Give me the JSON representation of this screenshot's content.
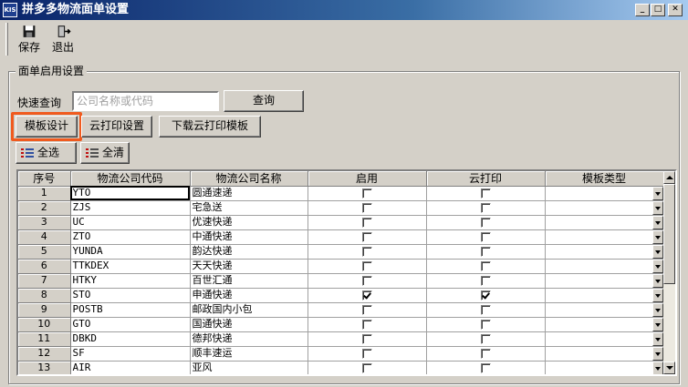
{
  "window": {
    "icon_text": "KIS",
    "title": "拼多多物流面单设置",
    "controls": {
      "minimize": "_",
      "maximize": "□",
      "close": "✕"
    }
  },
  "toolbar": {
    "save_label": "保存",
    "exit_label": "退出",
    "save_icon": "floppy-disk-icon",
    "exit_icon": "door-exit-icon"
  },
  "group": {
    "title": "面单启用设置",
    "search_label": "快速查询",
    "search_placeholder": "公司名称或代码",
    "search_value": "",
    "query_button": "查询",
    "template_design_button": "模板设计",
    "cloud_print_settings_button": "云打印设置",
    "download_cloud_template_button": "下载云打印模板",
    "select_all_button": "全选",
    "clear_all_button": "全清",
    "highlight_color": "#f05a1e"
  },
  "grid": {
    "columns": [
      "序号",
      "物流公司代码",
      "物流公司名称",
      "启用",
      "云打印",
      "模板类型"
    ],
    "rows": [
      {
        "index": "1",
        "code": "YTO",
        "name": "圆通速递",
        "enabled": false,
        "cloud": false,
        "template": ""
      },
      {
        "index": "2",
        "code": "ZJS",
        "name": "宅急送",
        "enabled": false,
        "cloud": false,
        "template": ""
      },
      {
        "index": "3",
        "code": "UC",
        "name": "优速快递",
        "enabled": false,
        "cloud": false,
        "template": ""
      },
      {
        "index": "4",
        "code": "ZTO",
        "name": "中通快递",
        "enabled": false,
        "cloud": false,
        "template": ""
      },
      {
        "index": "5",
        "code": "YUNDA",
        "name": "韵达快递",
        "enabled": false,
        "cloud": false,
        "template": ""
      },
      {
        "index": "6",
        "code": "TTKDEX",
        "name": "天天快递",
        "enabled": false,
        "cloud": false,
        "template": ""
      },
      {
        "index": "7",
        "code": "HTKY",
        "name": "百世汇通",
        "enabled": false,
        "cloud": false,
        "template": ""
      },
      {
        "index": "8",
        "code": "STO",
        "name": "申通快递",
        "enabled": true,
        "cloud": true,
        "template": ""
      },
      {
        "index": "9",
        "code": "POSTB",
        "name": "邮政国内小包",
        "enabled": false,
        "cloud": false,
        "template": ""
      },
      {
        "index": "10",
        "code": "GTO",
        "name": "国通快递",
        "enabled": false,
        "cloud": false,
        "template": ""
      },
      {
        "index": "11",
        "code": "DBKD",
        "name": "德邦快递",
        "enabled": false,
        "cloud": false,
        "template": ""
      },
      {
        "index": "12",
        "code": "SF",
        "name": "顺丰速运",
        "enabled": false,
        "cloud": false,
        "template": ""
      },
      {
        "index": "13",
        "code": "AIR",
        "name": "亚风",
        "enabled": false,
        "cloud": false,
        "template": ""
      }
    ]
  }
}
